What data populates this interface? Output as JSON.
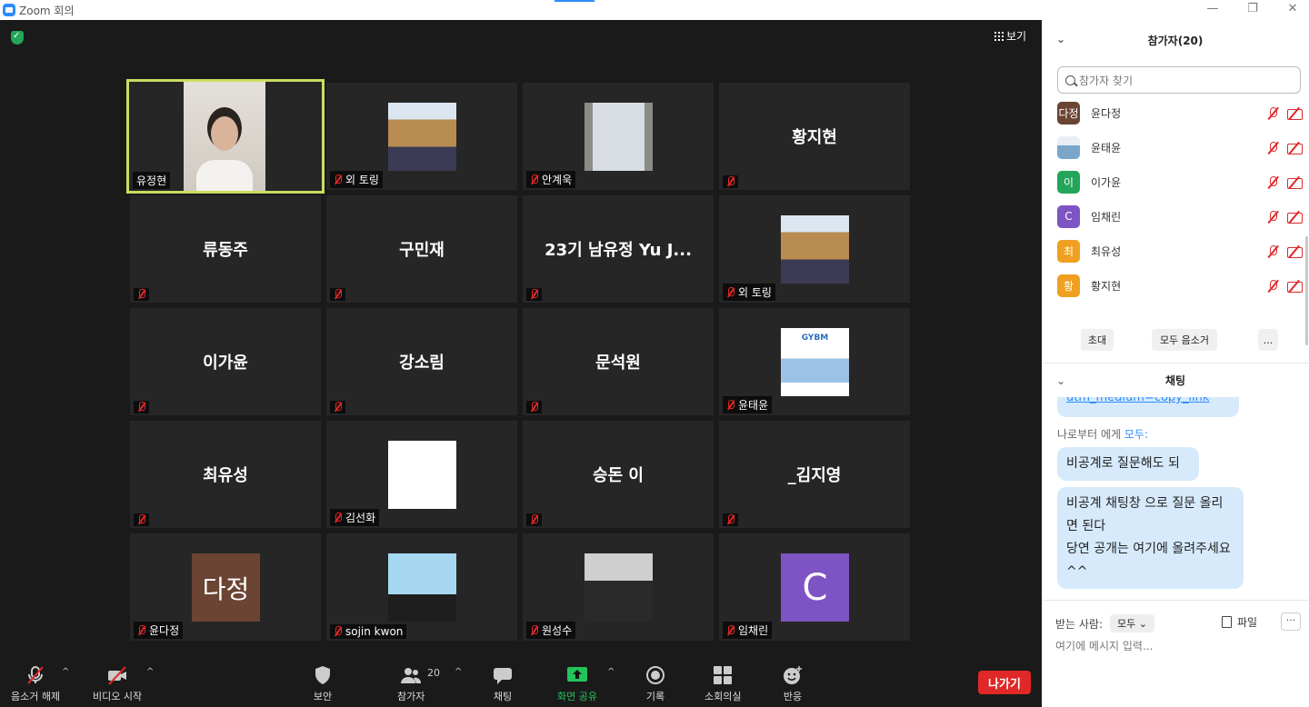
{
  "window": {
    "title": "Zoom 회의",
    "minimize": "—",
    "restore": "❐",
    "close": "✕"
  },
  "view_button": "보기",
  "tiles": [
    {
      "name": "유정현",
      "label": "유정현",
      "muted": false,
      "display": "video",
      "speaking": true
    },
    {
      "name": "외 토링",
      "label": "외 토링",
      "muted": true,
      "display": "image"
    },
    {
      "name": "안계욱",
      "label": "안계욱",
      "muted": true,
      "display": "image"
    },
    {
      "name": "황지현",
      "label": "",
      "muted": true,
      "display": "name"
    },
    {
      "name": "류동주",
      "label": "",
      "muted": true,
      "display": "name"
    },
    {
      "name": "구민재",
      "label": "",
      "muted": true,
      "display": "name"
    },
    {
      "name": "23기 남유정 Yu J...",
      "label": "",
      "muted": true,
      "display": "name"
    },
    {
      "name": "외 토링",
      "label": "외 토링",
      "muted": true,
      "display": "image"
    },
    {
      "name": "이가윤",
      "label": "",
      "muted": true,
      "display": "name"
    },
    {
      "name": "강소림",
      "label": "",
      "muted": true,
      "display": "name"
    },
    {
      "name": "문석원",
      "label": "",
      "muted": true,
      "display": "name"
    },
    {
      "name": "윤태윤",
      "label": "윤태윤",
      "muted": true,
      "display": "image",
      "image_text": "GYBM"
    },
    {
      "name": "최유성",
      "label": "",
      "muted": true,
      "display": "name"
    },
    {
      "name": "김선화",
      "label": "김선화",
      "muted": true,
      "display": "image"
    },
    {
      "name": "승돈 이",
      "label": "",
      "muted": true,
      "display": "name"
    },
    {
      "name": "_김지영",
      "label": "",
      "muted": true,
      "display": "name"
    },
    {
      "name": "윤다정",
      "label": "윤다정",
      "muted": true,
      "display": "avatar",
      "avatar_text": "다정",
      "avatar_color": "#6b4433"
    },
    {
      "name": "sojin kwon",
      "label": "sojin kwon",
      "muted": true,
      "display": "image"
    },
    {
      "name": "원성수",
      "label": "원성수",
      "muted": true,
      "display": "image"
    },
    {
      "name": "임채린",
      "label": "임채린",
      "muted": true,
      "display": "avatar",
      "avatar_text": "C",
      "avatar_color": "#7e54c4"
    }
  ],
  "toolbar": {
    "unmute": "음소거 해제",
    "video": "비디오 시작",
    "security": "보안",
    "participants": "참가자",
    "participants_count": "20",
    "chat": "채팅",
    "share": "화면 공유",
    "record": "기록",
    "breakout": "소회의실",
    "reactions": "반응",
    "leave": "나가기"
  },
  "participants_panel": {
    "title": "참가자(20)",
    "search_placeholder": "참가자 찾기",
    "list": [
      {
        "name": "윤다정",
        "avatar": "다정",
        "color": "#6b4433"
      },
      {
        "name": "윤태윤",
        "avatar": "",
        "color": "#7aa6c9"
      },
      {
        "name": "이가윤",
        "avatar": "이",
        "color": "#23a55a"
      },
      {
        "name": "임채린",
        "avatar": "C",
        "color": "#7e54c4"
      },
      {
        "name": "최유성",
        "avatar": "최",
        "color": "#f0a020"
      },
      {
        "name": "황지현",
        "avatar": "황",
        "color": "#f0a020"
      }
    ],
    "invite": "초대",
    "mute_all": "모두 음소거",
    "more": "..."
  },
  "chat": {
    "title": "채팅",
    "link_text": "utm_medium=copy_link",
    "from": "나로부터 에게",
    "to": "모두:",
    "messages": [
      "비공계로 질문해도 되",
      "비공계 채팅창 으로 질문 올리면 된다\n당연 공개는 여기에 올려주세요^^"
    ],
    "recipient_label": "받는 사람:",
    "recipient": "모두",
    "file": "파일",
    "more": "···",
    "input_placeholder": "여기에 메시지 입력..."
  },
  "colors": {
    "accent": "#2d8cff",
    "speaking_border": "#cadd61",
    "leave": "#e02828",
    "muted": "#e02828",
    "share": "#23c35a"
  }
}
